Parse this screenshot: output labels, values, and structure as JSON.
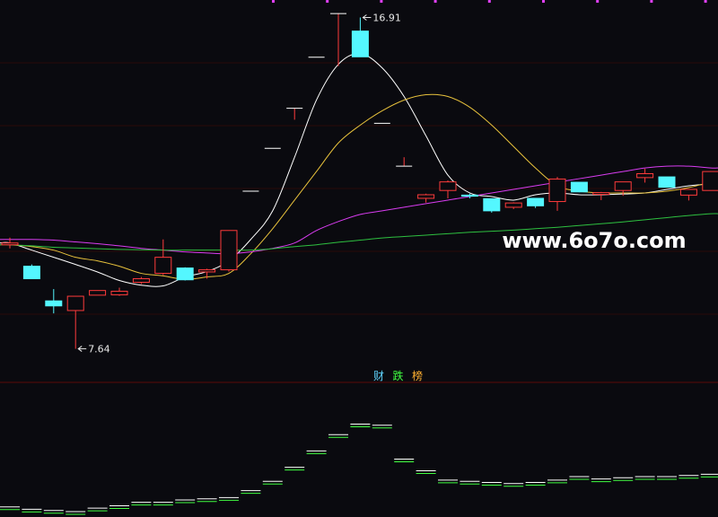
{
  "colors": {
    "background": "#0a0a0f",
    "up": "#ff3b3b",
    "down": "#54f7ff",
    "ma5": "#ffffff",
    "ma10": "#e8c23c",
    "ma20": "#d83cf0",
    "ma60": "#2ec040",
    "grid": "#2a0a0a",
    "divider": "#5a0a0a",
    "tick_mark": "#e040fb",
    "label": "#e8e8e8"
  },
  "watermark": "www.6o7o.com",
  "indicator_labels": [
    {
      "text": "财",
      "color": "#5fd5ff"
    },
    {
      "text": "跌",
      "color": "#40ff40"
    },
    {
      "text": "榜",
      "color": "#ffb030"
    }
  ],
  "chart_data": [
    {
      "type": "candlestick",
      "title": "",
      "ylim": [
        6.75,
        17.4
      ],
      "candles": [
        {
          "o": 10.55,
          "h": 10.75,
          "l": 10.45,
          "c": 10.6
        },
        {
          "o": 9.95,
          "h": 10.0,
          "l": 9.95,
          "c": 9.6
        },
        {
          "o": 8.98,
          "h": 9.31,
          "l": 8.63,
          "c": 8.84
        },
        {
          "o": 8.71,
          "h": 9.11,
          "l": 7.64,
          "c": 9.11
        },
        {
          "o": 9.14,
          "h": 9.27,
          "l": 9.14,
          "c": 9.27
        },
        {
          "o": 9.15,
          "h": 9.35,
          "l": 9.12,
          "c": 9.25
        },
        {
          "o": 9.5,
          "h": 9.65,
          "l": 9.45,
          "c": 9.6
        },
        {
          "o": 9.75,
          "h": 10.7,
          "l": 9.7,
          "c": 10.2
        },
        {
          "o": 9.9,
          "h": 9.92,
          "l": 9.55,
          "c": 9.57
        },
        {
          "o": 9.79,
          "h": 9.88,
          "l": 9.6,
          "c": 9.85
        },
        {
          "o": 9.85,
          "h": 10.92,
          "l": 9.8,
          "c": 10.95
        },
        {
          "o": 12.05,
          "h": 12.05,
          "l": 12.05,
          "c": 12.05
        },
        {
          "o": 13.25,
          "h": 13.25,
          "l": 13.25,
          "c": 13.25
        },
        {
          "o": 14.37,
          "h": 14.37,
          "l": 14.05,
          "c": 14.37
        },
        {
          "o": 15.8,
          "h": 15.8,
          "l": 15.8,
          "c": 15.8
        },
        {
          "o": 17.02,
          "h": 17.02,
          "l": 15.55,
          "c": 17.02
        },
        {
          "o": 16.53,
          "h": 16.91,
          "l": 15.81,
          "c": 15.81
        },
        {
          "o": 13.95,
          "h": 13.95,
          "l": 13.95,
          "c": 13.95
        },
        {
          "o": 12.75,
          "h": 13.0,
          "l": 12.75,
          "c": 12.75
        },
        {
          "o": 11.85,
          "h": 11.98,
          "l": 11.73,
          "c": 11.95
        },
        {
          "o": 12.07,
          "h": 12.35,
          "l": 11.85,
          "c": 12.31
        },
        {
          "o": 11.94,
          "h": 11.98,
          "l": 11.85,
          "c": 11.91
        },
        {
          "o": 11.84,
          "h": 11.84,
          "l": 11.45,
          "c": 11.5
        },
        {
          "o": 11.6,
          "h": 11.74,
          "l": 11.55,
          "c": 11.72
        },
        {
          "o": 11.85,
          "h": 11.85,
          "l": 11.58,
          "c": 11.64
        },
        {
          "o": 11.76,
          "h": 12.45,
          "l": 11.5,
          "c": 12.39
        },
        {
          "o": 12.3,
          "h": 12.3,
          "l": 12.02,
          "c": 12.03
        },
        {
          "o": 11.96,
          "h": 12.03,
          "l": 11.8,
          "c": 12.01
        },
        {
          "o": 12.07,
          "h": 12.31,
          "l": 11.92,
          "c": 12.31
        },
        {
          "o": 12.43,
          "h": 12.68,
          "l": 12.29,
          "c": 12.54
        },
        {
          "o": 12.45,
          "h": 12.45,
          "l": 12.17,
          "c": 12.16
        },
        {
          "o": 11.94,
          "h": 12.1,
          "l": 11.79,
          "c": 12.1
        },
        {
          "o": 12.07,
          "h": 12.61,
          "l": 12.1,
          "c": 12.6
        }
      ],
      "ma": [
        {
          "key": "ma5",
          "values": [
            10.6,
            10.4,
            10.2,
            10.0,
            9.79,
            9.55,
            9.42,
            9.4,
            9.65,
            9.8,
            10.1,
            10.7,
            11.5,
            13.0,
            14.6,
            15.6,
            15.9,
            15.5,
            14.7,
            13.6,
            12.5,
            12.0,
            11.9,
            11.8,
            11.95,
            12.0,
            11.95,
            11.95,
            11.97,
            12.0,
            12.1,
            12.2,
            12.25
          ]
        },
        {
          "key": "ma10",
          "values": [
            10.55,
            10.5,
            10.4,
            10.2,
            10.1,
            9.95,
            9.75,
            9.68,
            9.58,
            9.65,
            9.75,
            10.3,
            11.0,
            11.8,
            12.6,
            13.4,
            13.9,
            14.3,
            14.6,
            14.75,
            14.7,
            14.4,
            13.9,
            13.3,
            12.7,
            12.2,
            12.05,
            12.0,
            12.0,
            12.0,
            12.05,
            12.15,
            12.3
          ]
        },
        {
          "key": "ma20",
          "values": [
            10.7,
            10.7,
            10.68,
            10.63,
            10.58,
            10.52,
            10.45,
            10.4,
            10.35,
            10.32,
            10.3,
            10.35,
            10.45,
            10.6,
            10.95,
            11.2,
            11.4,
            11.5,
            11.6,
            11.7,
            11.8,
            11.9,
            12.0,
            12.1,
            12.2,
            12.3,
            12.4,
            12.5,
            12.6,
            12.7,
            12.75,
            12.75,
            12.7
          ]
        },
        {
          "key": "ma60",
          "values": [
            10.55,
            10.52,
            10.48,
            10.46,
            10.44,
            10.42,
            10.41,
            10.4,
            10.4,
            10.4,
            10.4,
            10.4,
            10.44,
            10.5,
            10.55,
            10.62,
            10.68,
            10.74,
            10.78,
            10.82,
            10.86,
            10.9,
            10.93,
            10.96,
            11.0,
            11.04,
            11.09,
            11.14,
            11.19,
            11.25,
            11.31,
            11.37,
            11.42
          ]
        }
      ],
      "annotations": [
        {
          "text": "16.91",
          "index": 16,
          "value": 16.91
        },
        {
          "text": "7.64",
          "index": 3,
          "value": 7.64
        }
      ]
    },
    {
      "type": "step",
      "title": "",
      "ylim": [
        0,
        100
      ],
      "values": [
        4,
        2,
        1,
        0,
        3,
        5,
        8,
        8,
        10,
        11,
        12,
        18,
        26,
        38,
        52,
        66,
        75,
        74,
        45,
        35,
        27,
        26,
        25,
        24,
        25,
        27,
        30,
        28,
        29,
        30,
        30,
        31,
        32
      ],
      "series_colors": [
        "#ffffff",
        "#40ff40"
      ]
    }
  ]
}
